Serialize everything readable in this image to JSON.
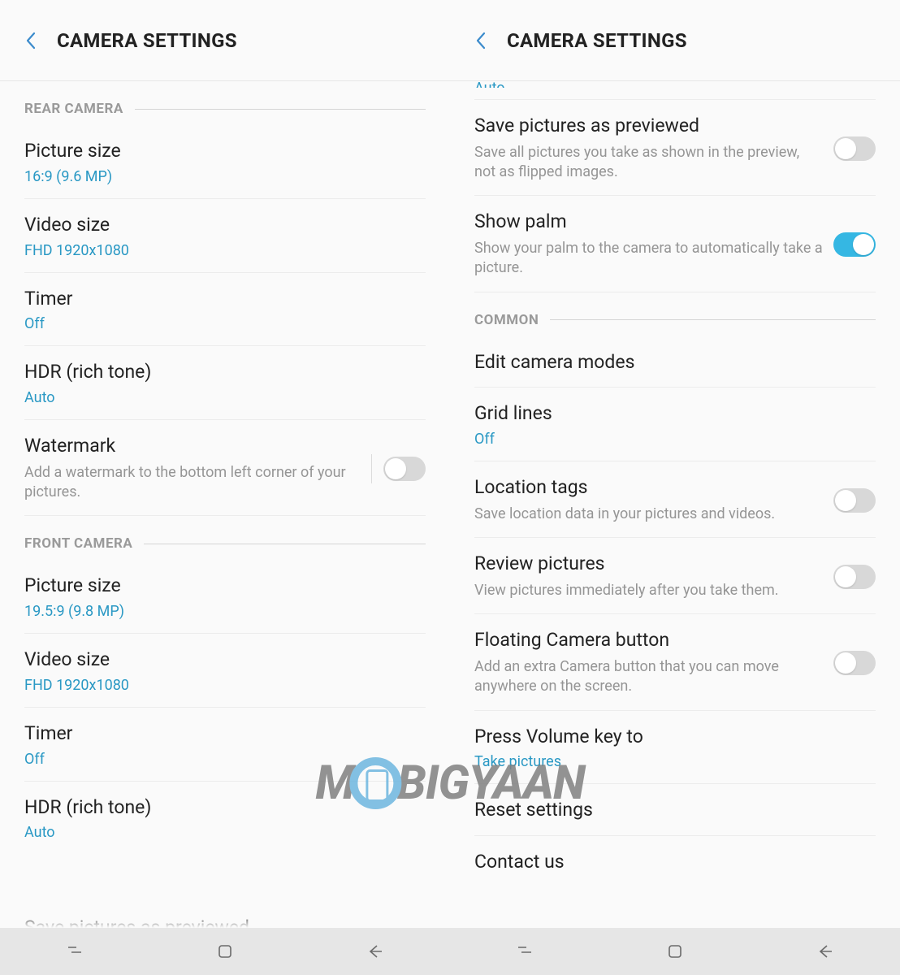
{
  "left": {
    "header": "CAMERA SETTINGS",
    "section1": "REAR CAMERA",
    "rows1": {
      "picture_size": {
        "title": "Picture size",
        "value": "16:9 (9.6 MP)"
      },
      "video_size": {
        "title": "Video size",
        "value": "FHD 1920x1080"
      },
      "timer": {
        "title": "Timer",
        "value": "Off"
      },
      "hdr": {
        "title": "HDR (rich tone)",
        "value": "Auto"
      },
      "watermark": {
        "title": "Watermark",
        "desc": "Add a watermark to the bottom left corner of your pictures."
      }
    },
    "section2": "FRONT CAMERA",
    "rows2": {
      "picture_size": {
        "title": "Picture size",
        "value": "19.5:9 (9.8 MP)"
      },
      "video_size": {
        "title": "Video size",
        "value": "FHD 1920x1080"
      },
      "timer": {
        "title": "Timer",
        "value": "Off"
      },
      "hdr": {
        "title": "HDR (rich tone)",
        "value": "Auto"
      }
    },
    "partial_bottom": "Save pictures as previewed"
  },
  "right": {
    "header": "CAMERA SETTINGS",
    "partial_top": "Auto",
    "rows1": {
      "save_preview": {
        "title": "Save pictures as previewed",
        "desc": "Save all pictures you take as shown in the preview, not as flipped images."
      },
      "show_palm": {
        "title": "Show palm",
        "desc": "Show your palm to the camera to automatically take a picture."
      }
    },
    "section": "COMMON",
    "rows2": {
      "edit_modes": {
        "title": "Edit camera modes"
      },
      "grid": {
        "title": "Grid lines",
        "value": "Off"
      },
      "location": {
        "title": "Location tags",
        "desc": "Save location data in your pictures and videos."
      },
      "review": {
        "title": "Review pictures",
        "desc": "View pictures immediately after you take them."
      },
      "floating": {
        "title": "Floating Camera button",
        "desc": "Add an extra Camera button that you can move anywhere on the screen."
      },
      "volume": {
        "title": "Press Volume key to",
        "value": "Take pictures"
      },
      "reset": {
        "title": "Reset settings"
      },
      "contact": {
        "title": "Contact us"
      }
    }
  },
  "watermark": {
    "pre": "M",
    "post": "BIGYAAN"
  }
}
